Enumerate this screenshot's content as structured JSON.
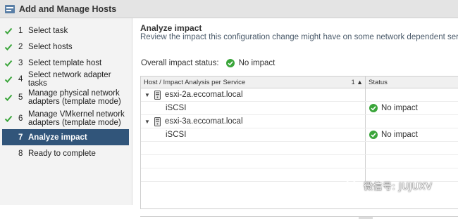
{
  "window": {
    "title": "Add and Manage Hosts"
  },
  "steps": [
    {
      "num": "1",
      "label": "Select task",
      "done": true
    },
    {
      "num": "2",
      "label": "Select hosts",
      "done": true
    },
    {
      "num": "3",
      "label": "Select template host",
      "done": true
    },
    {
      "num": "4",
      "label": "Select network adapter tasks",
      "done": true
    },
    {
      "num": "5",
      "label_line1": "Manage physical network",
      "label_line2": "adapters (template mode)",
      "done": true
    },
    {
      "num": "6",
      "label_line1": "Manage VMkernel network",
      "label_line2": "adapters (template mode)",
      "done": true
    },
    {
      "num": "7",
      "label": "Analyze impact",
      "active": true
    },
    {
      "num": "8",
      "label": "Ready to complete"
    }
  ],
  "main": {
    "title": "Analyze impact",
    "description": "Review the impact this configuration change might have on some network dependent services.",
    "overall_label": "Overall impact status:",
    "overall_value": "No impact"
  },
  "grid": {
    "col1": "Host / Impact Analysis per Service",
    "sort_indicator": "1 ▲",
    "col2": "Status",
    "rows": [
      {
        "host": "esxi-2a.eccomat.local",
        "service": "iSCSI",
        "status": "No impact"
      },
      {
        "host": "esxi-3a.eccomat.local",
        "service": "iSCSI",
        "status": "No impact"
      }
    ]
  },
  "watermark": {
    "text": "微信号: JUJUXV"
  },
  "colors": {
    "active_step": "#31557a",
    "ok_green": "#3aa53a"
  },
  "icons": {
    "app": "wizard-icon",
    "check": "checkmark-icon",
    "ok": "ok-status-icon",
    "server": "server-icon",
    "expand": "expand-triangle-icon"
  }
}
